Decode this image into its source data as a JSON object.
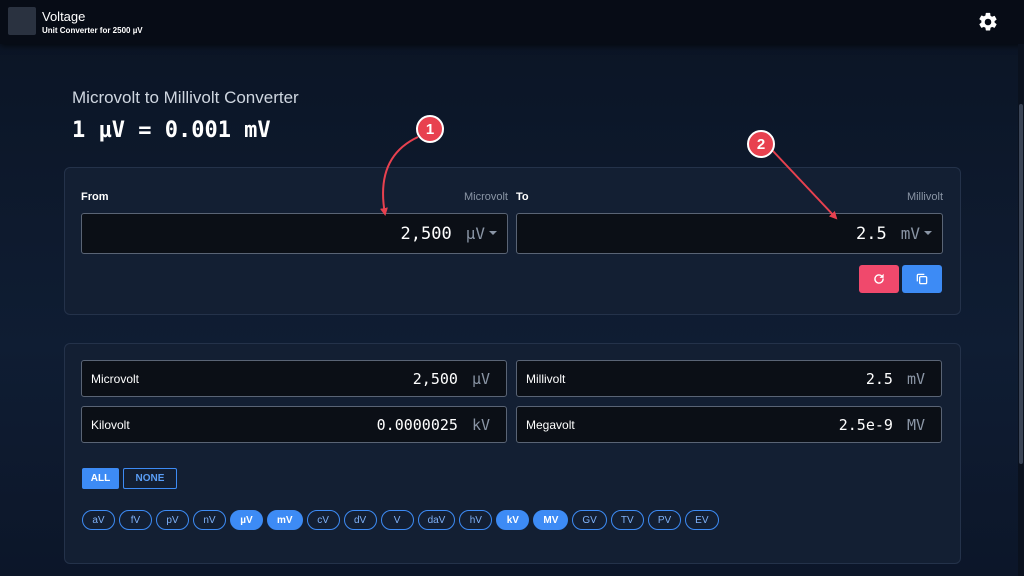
{
  "app": {
    "title": "Voltage",
    "subtitle": "Unit Converter for 2500 µV"
  },
  "converter": {
    "title": "Microvolt to Millivolt Converter",
    "formula": "1 µV = 0.001 mV",
    "from": {
      "label": "From",
      "unit_name": "Microvolt",
      "value": "2,500",
      "unit_symbol": "µV"
    },
    "to": {
      "label": "To",
      "unit_name": "Millivolt",
      "value": "2.5",
      "unit_symbol": "mV"
    }
  },
  "results": [
    {
      "name": "Microvolt",
      "value": "2,500",
      "unit": "µV"
    },
    {
      "name": "Millivolt",
      "value": "2.5",
      "unit": "mV"
    },
    {
      "name": "Kilovolt",
      "value": "0.0000025",
      "unit": "kV"
    },
    {
      "name": "Megavolt",
      "value": "2.5e-9",
      "unit": "MV"
    }
  ],
  "selectors": {
    "all_label": "ALL",
    "none_label": "NONE"
  },
  "chips": [
    {
      "label": "aV",
      "on": false
    },
    {
      "label": "fV",
      "on": false
    },
    {
      "label": "pV",
      "on": false
    },
    {
      "label": "nV",
      "on": false
    },
    {
      "label": "µV",
      "on": true
    },
    {
      "label": "mV",
      "on": true
    },
    {
      "label": "cV",
      "on": false
    },
    {
      "label": "dV",
      "on": false
    },
    {
      "label": "V",
      "on": false
    },
    {
      "label": "daV",
      "on": false
    },
    {
      "label": "hV",
      "on": false
    },
    {
      "label": "kV",
      "on": true
    },
    {
      "label": "MV",
      "on": true
    },
    {
      "label": "GV",
      "on": false
    },
    {
      "label": "TV",
      "on": false
    },
    {
      "label": "PV",
      "on": false
    },
    {
      "label": "EV",
      "on": false
    }
  ],
  "annotations": {
    "badge_1": "1",
    "badge_2": "2",
    "color": "#e8414f"
  },
  "colors": {
    "accent": "#3d8bf5",
    "reset": "#f0496c"
  },
  "icons": {
    "settings": "gear-icon",
    "reset": "refresh-icon",
    "copy": "copy-icon"
  }
}
